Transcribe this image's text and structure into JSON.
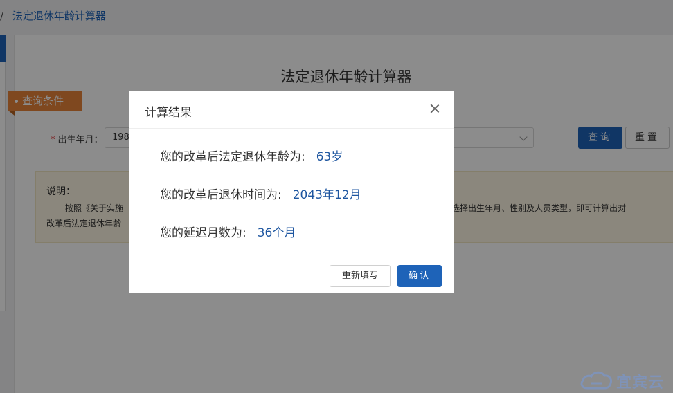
{
  "breadcrumb": {
    "separator": "/",
    "current": "法定退休年龄计算器"
  },
  "page": {
    "title": "法定退休年龄计算器"
  },
  "section": {
    "label": "查询条件"
  },
  "form": {
    "birth_label": "出生年月：",
    "required_mark": "*",
    "birth_value": "198",
    "query_button": "查询",
    "reset_button": "重置"
  },
  "note": {
    "title": "说明：",
    "line1_start": "按照《关于实施",
    "line1_end": "器，选择出生年月、性别及人员类型，即可计算出对",
    "line2": "改革后法定退休年龄"
  },
  "dialog": {
    "title": "计算结果",
    "rows": [
      {
        "label": "您的改革后法定退休年龄为:",
        "value": "63岁"
      },
      {
        "label": "您的改革后退休时间为:",
        "value": "2043年12月"
      },
      {
        "label": "您的延迟月数为:",
        "value": "36个月"
      }
    ],
    "refill_button": "重新填写",
    "confirm_button": "确认"
  },
  "watermark": {
    "text": "宜宾云",
    "icon": "cloud-icon"
  },
  "colors": {
    "primary": "#1e63b8",
    "tag": "#e8843a",
    "value_text": "#1e56a0"
  }
}
